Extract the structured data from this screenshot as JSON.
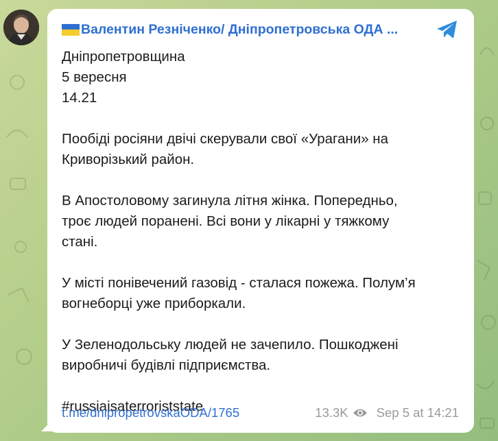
{
  "channel": {
    "name": "Валентин Резніченко/ Дніпропетровська ОДА ...",
    "flag_colors": [
      "#2f6fd1",
      "#f4cc2b"
    ]
  },
  "message": {
    "lines_intro": [
      "Дніпропетровщина",
      "5 вересня",
      "14.21"
    ],
    "paragraphs": [
      [
        "Пообіді росіяни двічі скерували свої «Урагани» на",
        "Криворізький район."
      ],
      [
        "В Апостоловому загинула літня жінка. Попередньо,",
        "троє людей поранені. Всі вони у лікарні у тяжкому",
        "стані."
      ],
      [
        "У місті понівечений газовід - сталася пожежа. Полум’я",
        "вогнеборці уже приборкали."
      ],
      [
        "У Зеленодольську людей не зачепило. Пошкоджені",
        "виробничі будівлі підприємства."
      ]
    ],
    "hashtag": "#russiaisaterroriststate"
  },
  "footer": {
    "link": "t.me/dnipropetrovskaODA/1765",
    "views": "13.3K",
    "timestamp": "Sep 5 at 14:21"
  },
  "icons": {
    "telegram": "telegram-icon",
    "views": "eye-icon",
    "avatar": "avatar"
  },
  "colors": {
    "accent": "#2f6fd1",
    "background_start": "#c9d99a",
    "background_end": "#93bd7f",
    "meta_text": "#9a9a9a"
  }
}
